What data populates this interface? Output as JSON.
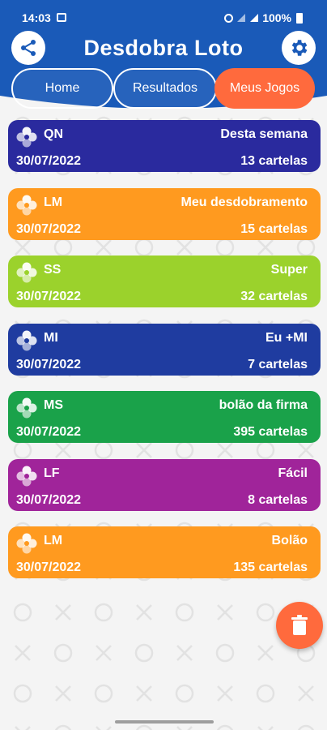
{
  "status": {
    "time": "14:03",
    "battery": "100%"
  },
  "app": {
    "title": "Desdobra Loto"
  },
  "tabs": [
    {
      "label": "Home",
      "active": false
    },
    {
      "label": "Resultados",
      "active": false
    },
    {
      "label": "Meus Jogos",
      "active": true
    }
  ],
  "colors": {
    "header": "#1a5ab8",
    "accent": "#ff6a3d"
  },
  "games": [
    {
      "code": "QN",
      "name": "Desta semana",
      "date": "30/07/2022",
      "count": "13  cartelas",
      "color": "#2a2a9e"
    },
    {
      "code": "LM",
      "name": "Meu desdobramento",
      "date": "30/07/2022",
      "count": "15  cartelas",
      "color": "#ff9a1f"
    },
    {
      "code": "SS",
      "name": "Super",
      "date": "30/07/2022",
      "count": "32  cartelas",
      "color": "#9bd22c"
    },
    {
      "code": "MI",
      "name": "Eu +MI",
      "date": "30/07/2022",
      "count": "7  cartelas",
      "color": "#1f3ca0"
    },
    {
      "code": "MS",
      "name": "bolão da firma",
      "date": "30/07/2022",
      "count": "395  cartelas",
      "color": "#1aa24a"
    },
    {
      "code": "LF",
      "name": "Fácil",
      "date": "30/07/2022",
      "count": "8  cartelas",
      "color": "#a0249a"
    },
    {
      "code": "LM",
      "name": "Bolão",
      "date": "30/07/2022",
      "count": "135  cartelas",
      "color": "#ff9a1f"
    }
  ],
  "icons": {
    "share": "share-icon",
    "settings": "gear-icon",
    "delete": "trash-icon"
  }
}
